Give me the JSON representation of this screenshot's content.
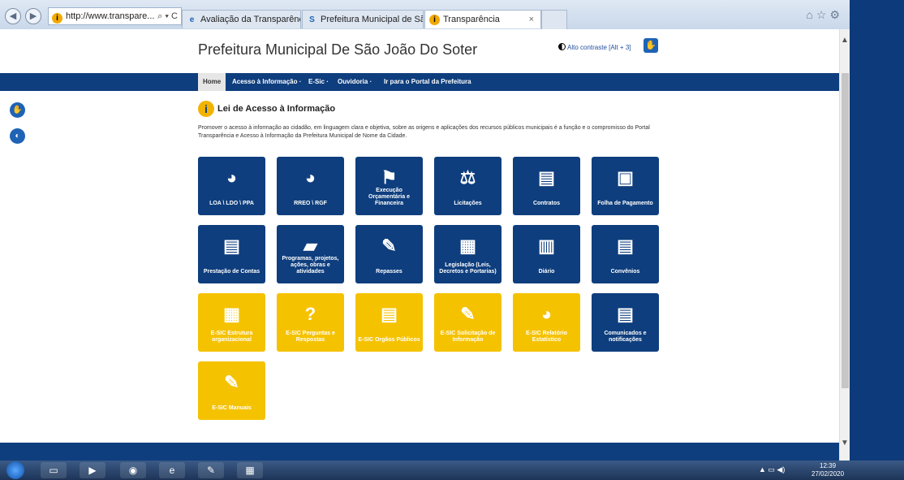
{
  "browser": {
    "address": "http://www.transpare...",
    "address_controls": "⌕ ▾ C",
    "tabs": [
      {
        "label": "Avaliação da Transparência do...",
        "active": false
      },
      {
        "label": "Prefeitura Municipal de São Jo...",
        "active": false
      },
      {
        "label": "Transparência",
        "active": true
      }
    ],
    "close_glyph": "×"
  },
  "site": {
    "title": "Prefeitura Municipal De São João Do Soter",
    "contrast_label": "Alto contraste [Alt + 3]"
  },
  "nav": {
    "items": [
      "Home",
      "Acesso à Informação ·",
      "E-Sic ·",
      "Ouvidoria ·",
      "Ir para o Portal da Prefeitura"
    ]
  },
  "section": {
    "badge": "i",
    "title": "Lei de Acesso à Informação",
    "intro": "Promover o acesso à informação ao cidadão, em linguagem clara e objetiva, sobre as origens e aplicações dos recursos públicos municipais é a função e o compromisso do Portal Transparência e Acesso à Informação da Prefeitura Municipal de Nome da Cidade."
  },
  "tiles": [
    {
      "label": "LOA \\ LDO \\ PPA",
      "icon": "coins-chart-icon",
      "glyph": "◕",
      "color": "blue"
    },
    {
      "label": "RREO \\ RGF",
      "icon": "coins-chart-icon",
      "glyph": "◕",
      "color": "blue"
    },
    {
      "label": "Execução Orçamentária e Financeira",
      "icon": "presentation-icon",
      "glyph": "⚑",
      "color": "blue"
    },
    {
      "label": "Licitações",
      "icon": "gavel-icon",
      "glyph": "⚖",
      "color": "blue"
    },
    {
      "label": "Contratos",
      "icon": "documents-icon",
      "glyph": "▤",
      "color": "blue"
    },
    {
      "label": "Folha de Pagamento",
      "icon": "clipboard-icon",
      "glyph": "▣",
      "color": "blue"
    },
    {
      "label": "Prestação de Contas",
      "icon": "documents-icon",
      "glyph": "▤",
      "color": "blue"
    },
    {
      "label": "Programas, projetos, ações, obras e atividades",
      "icon": "folder-icon",
      "glyph": "▰",
      "color": "blue"
    },
    {
      "label": "Repasses",
      "icon": "edit-document-icon",
      "glyph": "✎",
      "color": "blue"
    },
    {
      "label": "Legislação (Leis, Decretos e Portarias)",
      "icon": "calendar-icon",
      "glyph": "▦",
      "color": "blue"
    },
    {
      "label": "Diário",
      "icon": "books-icon",
      "glyph": "▥",
      "color": "blue"
    },
    {
      "label": "Convênios",
      "icon": "documents-icon",
      "glyph": "▤",
      "color": "blue"
    },
    {
      "label": "E-SIC Estrutura organizacional",
      "icon": "org-structure-icon",
      "glyph": "▦",
      "color": "yellow"
    },
    {
      "label": "E-SIC Perguntas e Respostas",
      "icon": "question-person-icon",
      "glyph": "?",
      "color": "yellow"
    },
    {
      "label": "E-SIC Orgãos Públicos",
      "icon": "documents-icon",
      "glyph": "▤",
      "color": "yellow"
    },
    {
      "label": "E-SIC Solicitação de Informação",
      "icon": "edit-document-icon",
      "glyph": "✎",
      "color": "yellow"
    },
    {
      "label": "E-SIC Relatório Estatístico",
      "icon": "coins-chart-icon",
      "glyph": "◕",
      "color": "yellow"
    },
    {
      "label": "Comunicados e notificações",
      "icon": "documents-icon",
      "glyph": "▤",
      "color": "blue"
    },
    {
      "label": "E-SIC Manuais",
      "icon": "edit-document-icon",
      "glyph": "✎",
      "color": "yellow"
    }
  ],
  "taskbar": {
    "time": "12:39",
    "date": "27/02/2020"
  },
  "colors": {
    "navy": "#0e3e7e",
    "yellow": "#f5c200",
    "accent_blue": "#1e63b5"
  }
}
